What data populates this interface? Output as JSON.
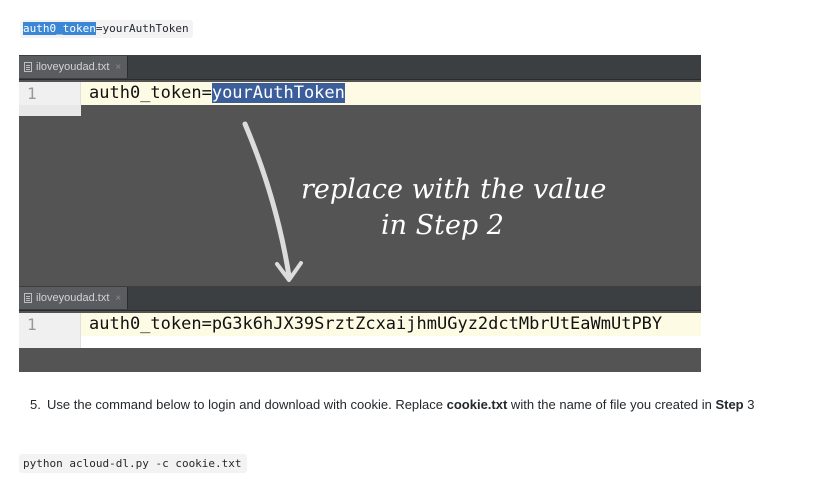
{
  "top_code": {
    "selected": "auth0_token",
    "rest": "=yourAuthToken"
  },
  "editor_top": {
    "tab_label": "iloveyoudad.txt",
    "tab_close": "×",
    "line_number": "1",
    "code_prefix": "auth0_token=",
    "code_selected": "yourAuthToken"
  },
  "annotation": {
    "line1": "replace with the value",
    "line2": "in Step 2"
  },
  "editor_bottom": {
    "tab_label": "iloveyoudad.txt",
    "tab_close": "×",
    "line_number": "1",
    "code": "auth0_token=pG3k6hJX39SrztZcxaijhmUGyz2dctMbrUtEaWmUtPBY"
  },
  "instruction": {
    "number": "5.",
    "text_before": "Use the command below to login and download with cookie. Replace ",
    "bold_file": "cookie.txt",
    "text_middle": " with the name of file you created in ",
    "bold_step": "Step",
    "text_after": " 3"
  },
  "command": "python acloud-dl.py -c cookie.txt",
  "colors": {
    "selection_blue": "#3b87d6",
    "editor_bg": "#545454",
    "line_highlight": "#fefbe5"
  }
}
